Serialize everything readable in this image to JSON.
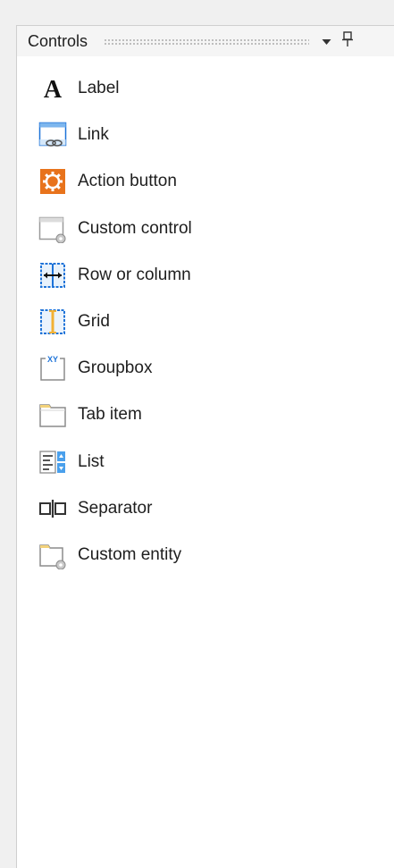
{
  "panel": {
    "title": "Controls",
    "dropdown_glyph": "▼",
    "pin_glyph": "📌"
  },
  "items": [
    {
      "label": "Label",
      "icon": "label-a-icon"
    },
    {
      "label": "Link",
      "icon": "link-chain-icon"
    },
    {
      "label": "Action button",
      "icon": "action-gear-icon"
    },
    {
      "label": "Custom control",
      "icon": "custom-control-icon"
    },
    {
      "label": "Row or column",
      "icon": "row-column-icon"
    },
    {
      "label": "Grid",
      "icon": "grid-icon"
    },
    {
      "label": "Groupbox",
      "icon": "groupbox-icon"
    },
    {
      "label": "Tab item",
      "icon": "tab-item-icon"
    },
    {
      "label": "List",
      "icon": "list-icon"
    },
    {
      "label": "Separator",
      "icon": "separator-icon"
    },
    {
      "label": "Custom entity",
      "icon": "custom-entity-icon"
    }
  ],
  "colors": {
    "accent_blue": "#1e73d8",
    "action_orange": "#e8731c",
    "grid_yellow": "#f2b134"
  }
}
